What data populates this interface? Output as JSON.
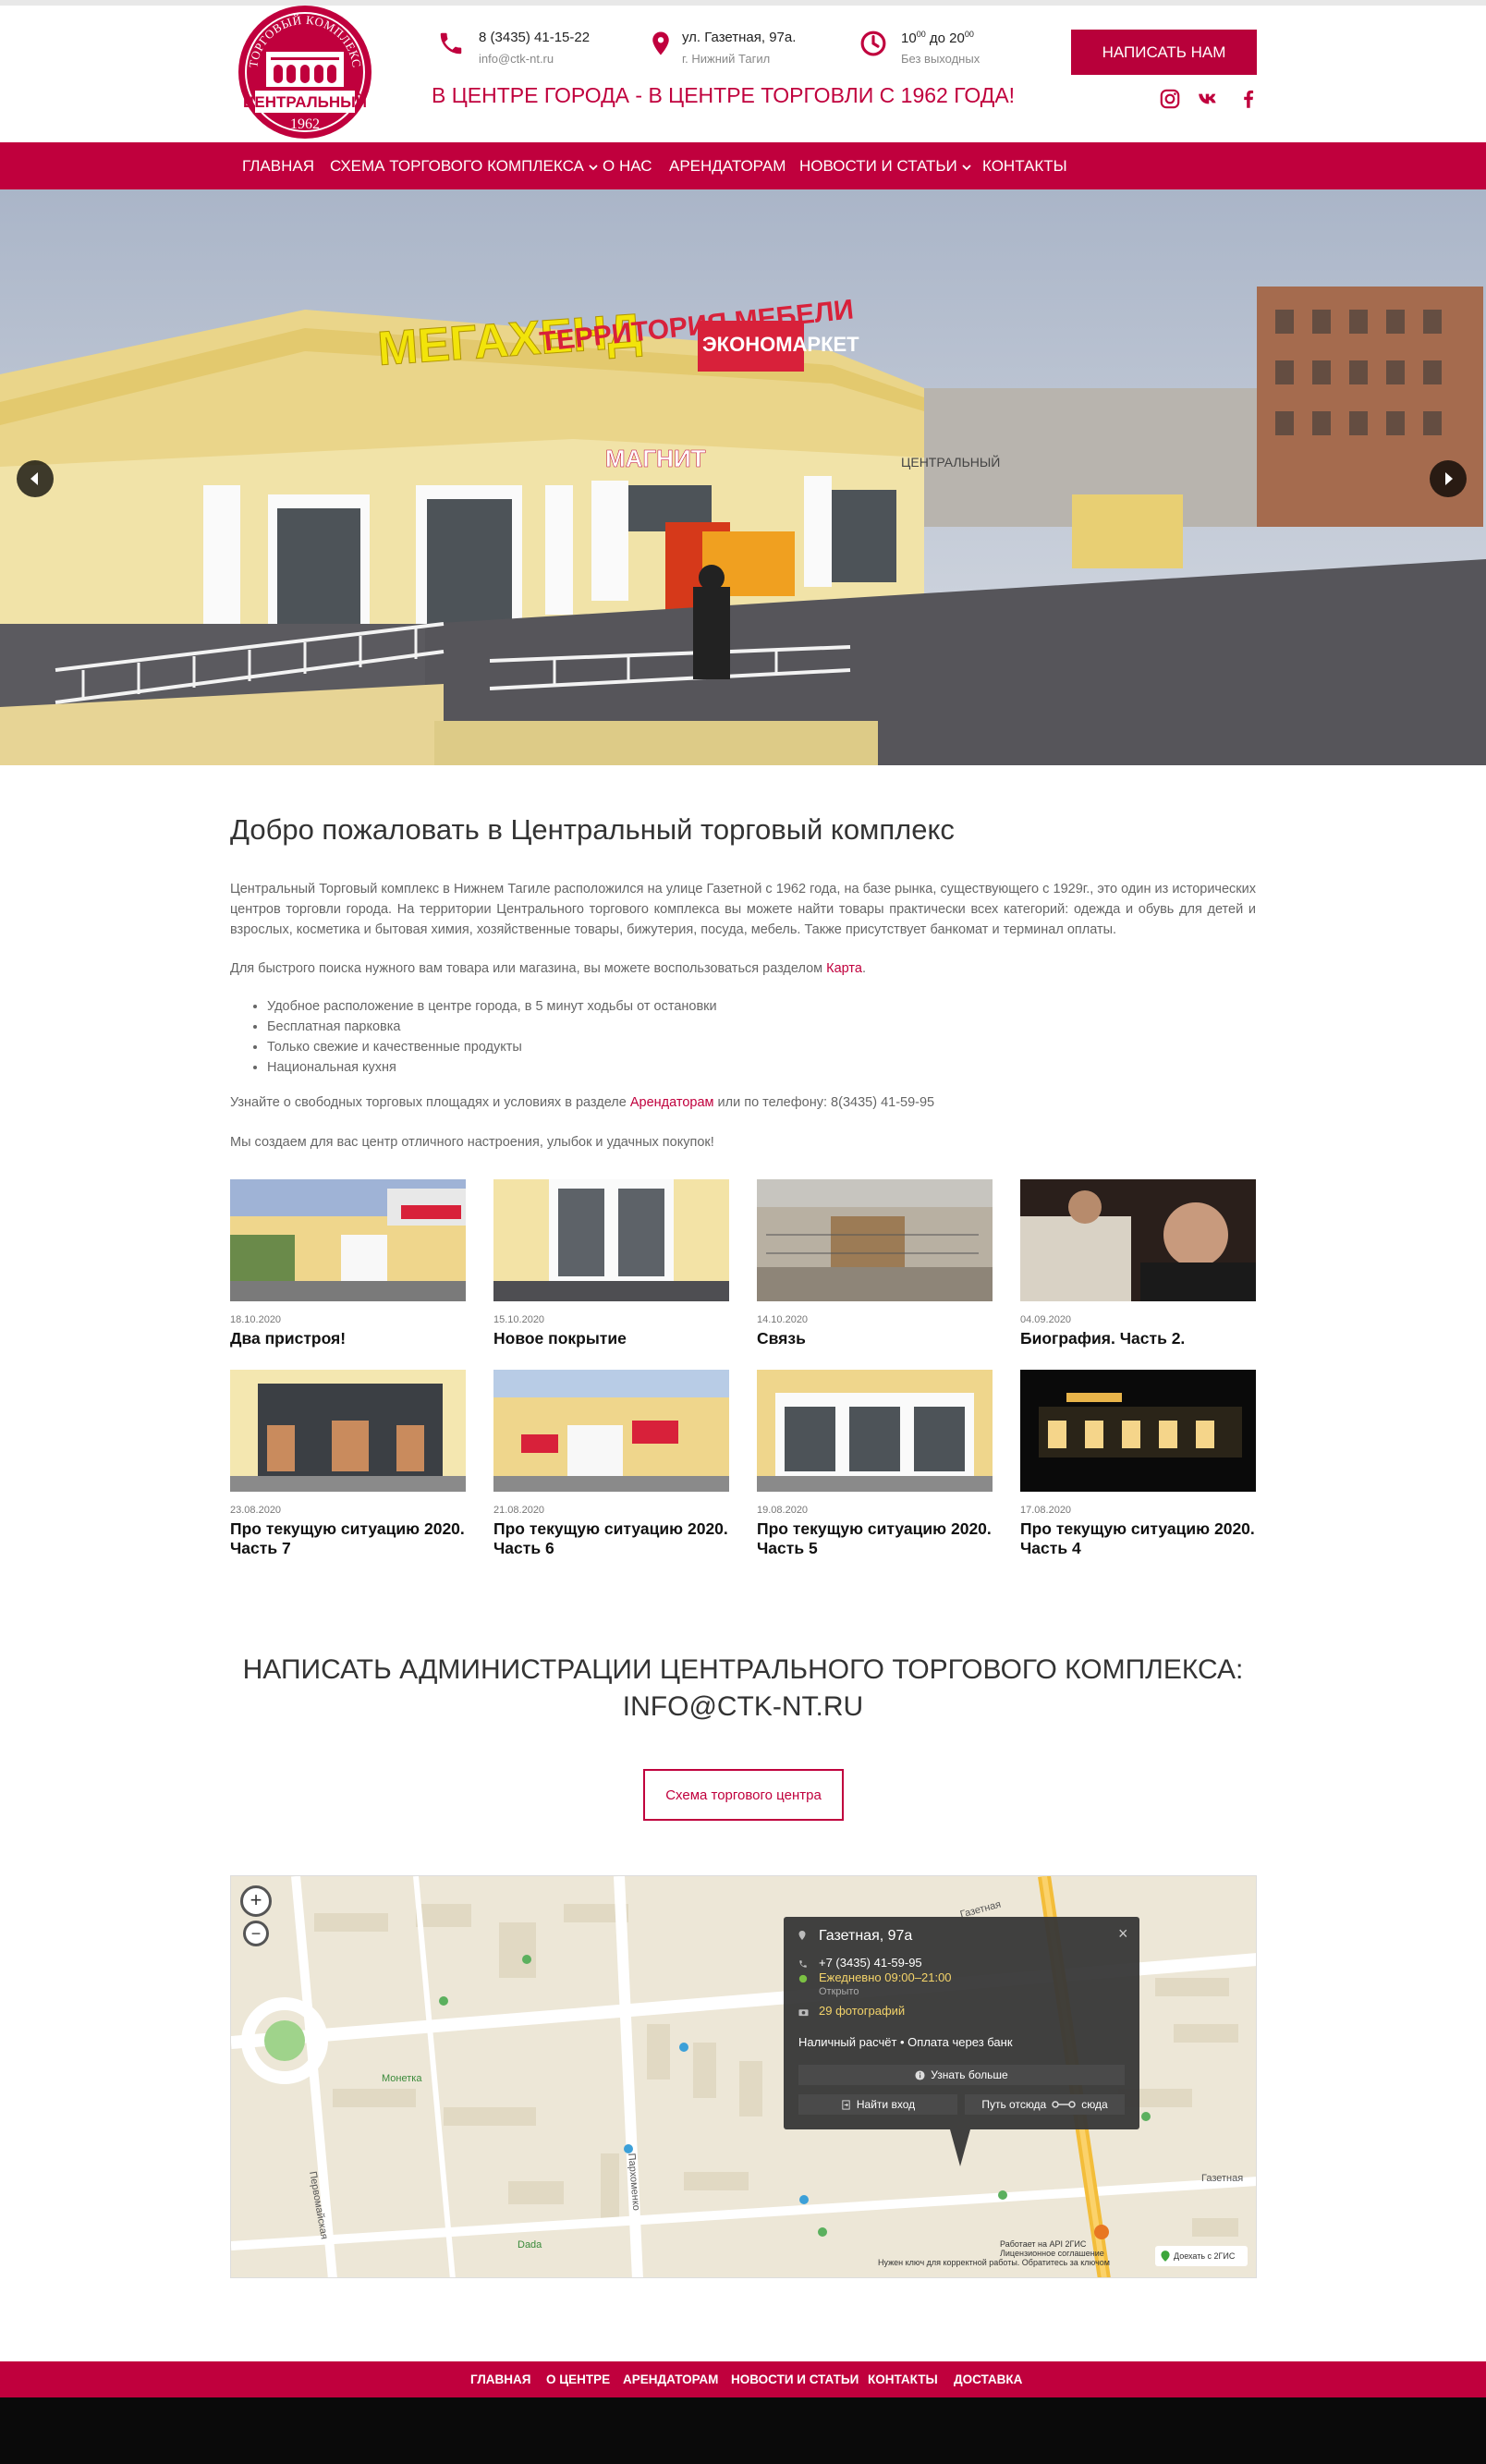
{
  "brand": {
    "logo_arc_text": "ТОРГОВЫЙ КОМПЛЕКС",
    "logo_name": "ЦЕНТРАЛЬНЫЙ",
    "logo_year": "1962",
    "accent_color": "#c0003d"
  },
  "header": {
    "phone": "8 (3435) 41-15-22",
    "email": "info@ctk-nt.ru",
    "address": "ул. Газетная, 97а.",
    "city": "г. Нижний Тагил",
    "hours_from": "10",
    "hours_from_sup": "00",
    "hours_sep": "до",
    "hours_to": "20",
    "hours_to_sup": "00",
    "hours_note": "Без выходных",
    "tagline": "В ЦЕНТРЕ ГОРОДА - В ЦЕНТРЕ ТОРГОВЛИ С 1962 ГОДА!",
    "write_button": "НАПИСАТЬ НАМ",
    "icons": [
      "phone-icon",
      "location-pin-icon",
      "clock-icon",
      "instagram-icon",
      "vk-icon",
      "facebook-icon"
    ]
  },
  "nav": {
    "items": [
      "ГЛАВНАЯ",
      "СХЕМА ТОРГОВОГО КОМПЛЕКСА",
      "О НАС",
      "АРЕНДАТОРАМ",
      "НОВОСТИ И СТАТЬИ",
      "КОНТАКТЫ"
    ]
  },
  "hero": {
    "signs": [
      "МЕГАХЕНД",
      "ТЕРРИТОРИЯ МЕБЕЛИ",
      "ЭКОНОМАРКЕТ",
      "МАГНИТ",
      "ЦЕНТРАЛЬНЫЙ"
    ]
  },
  "main": {
    "title": "Добро пожаловать в Центральный торговый комплекс",
    "intro": "Центральный Торговый комплекс в Нижнем Тагиле расположился на улице Газетной с 1962 года, на базе рынка, существующего с 1929г., это один из исторических центров торговли города. На территории Центрального торгового комплекса вы можете найти товары практически всех категорий: одежда и обувь для детей и взрослых, косметика  и бытовая химия, хозяйственные товары, бижутерия, посуда, мебель. Также присутствует банкомат и терминал оплаты.",
    "search_pre": "Для быстрого поиска нужного вам товара или магазина, вы можете воспользоваться разделом ",
    "search_link": "Карта",
    "search_post": ".",
    "bullets": [
      "Удобное расположение в центре города, в 5 минут ходьбы от остановки",
      "Бесплатная парковка",
      "Только свежие и качественные продукты",
      "Национальная кухня"
    ],
    "rent_pre": "Узнайте о свободных торговых площадях и условиях в разделе ",
    "rent_link": "Арендаторам",
    "rent_post": " или по телефону: 8(3435) 41-59-95",
    "closing": "Мы создаем для вас центр отличного настроения, улыбок и удачных покупок!"
  },
  "news": [
    {
      "date": "18.10.2020",
      "title": "Два пристроя!"
    },
    {
      "date": "15.10.2020",
      "title": "Новое покрытие"
    },
    {
      "date": "14.10.2020",
      "title": "Связь"
    },
    {
      "date": "04.09.2020",
      "title": "Биография. Часть 2."
    },
    {
      "date": "23.08.2020",
      "title": "Про текущую ситуацию 2020. Часть 7"
    },
    {
      "date": "21.08.2020",
      "title": "Про текущую ситуацию 2020. Часть 6"
    },
    {
      "date": "19.08.2020",
      "title": "Про текущую ситуацию 2020. Часть 5"
    },
    {
      "date": "17.08.2020",
      "title": "Про текущую ситуацию 2020. Часть 4"
    }
  ],
  "cta": {
    "line1": "Написать администрации Центрального торгового комплекса:",
    "line2": "info@ctk-nt.ru",
    "scheme_button": "Схема торгового центра"
  },
  "map": {
    "zoom_in": "+",
    "zoom_out": "−",
    "popup": {
      "address": "Газетная, 97а",
      "close": "×",
      "phone": "+7 (3435) 41-59-95",
      "hours": "Ежедневно 09:00–21:00",
      "status": "Открыто",
      "photos": "29 фотографий",
      "payment": "Наличный расчёт • Оплата через банк",
      "more_button": "Узнать больше",
      "entrance_button": "Найти вход",
      "route_from": "Путь отсюда",
      "route_to": "сюда"
    },
    "street_labels": [
      "Газетная",
      "Пархоменко",
      "Первомайская",
      "Газетная",
      "Монетка",
      "Dada"
    ],
    "api_notice_1": "Работает на API 2ГИС",
    "api_notice_2": "Нужен ключ для корректной работы. Обратитесь за ключом",
    "license": "Лицензионное соглашение",
    "to_2gis": "Доехать с 2ГИС"
  },
  "footer": {
    "items": [
      "ГЛАВНАЯ",
      "О ЦЕНТРЕ",
      "АРЕНДАТОРАМ",
      "НОВОСТИ И СТАТЬИ",
      "КОНТАКТЫ",
      "ДОСТАВКА"
    ]
  }
}
